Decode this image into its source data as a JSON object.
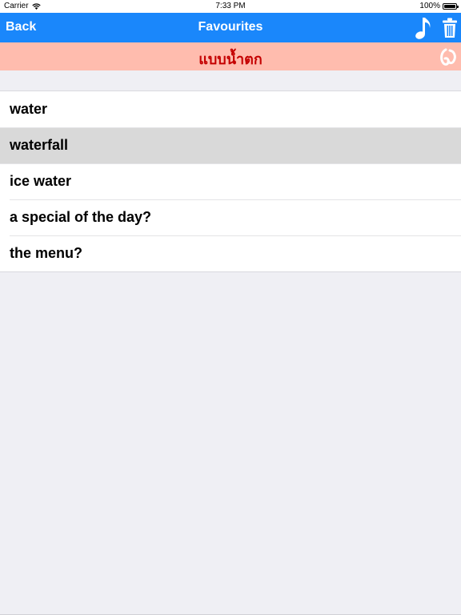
{
  "status_bar": {
    "carrier": "Carrier",
    "time": "7:33 PM",
    "battery": "100%",
    "battery_level": 1.0
  },
  "nav": {
    "back_label": "Back",
    "title": "Favourites",
    "music_icon": "music-note-icon",
    "trash_icon": "trash-icon",
    "background_color": "#1a87fb"
  },
  "translation": {
    "text": "แบบน้ำตก",
    "text_color": "#c40000",
    "background_color": "#ffbcae",
    "speak_icon": "speaker-icon"
  },
  "favourites": [
    {
      "label": "water",
      "selected": false
    },
    {
      "label": "waterfall",
      "selected": true
    },
    {
      "label": "ice water",
      "selected": false
    },
    {
      "label": "a special of the day?",
      "selected": false
    },
    {
      "label": "the menu?",
      "selected": false
    }
  ]
}
